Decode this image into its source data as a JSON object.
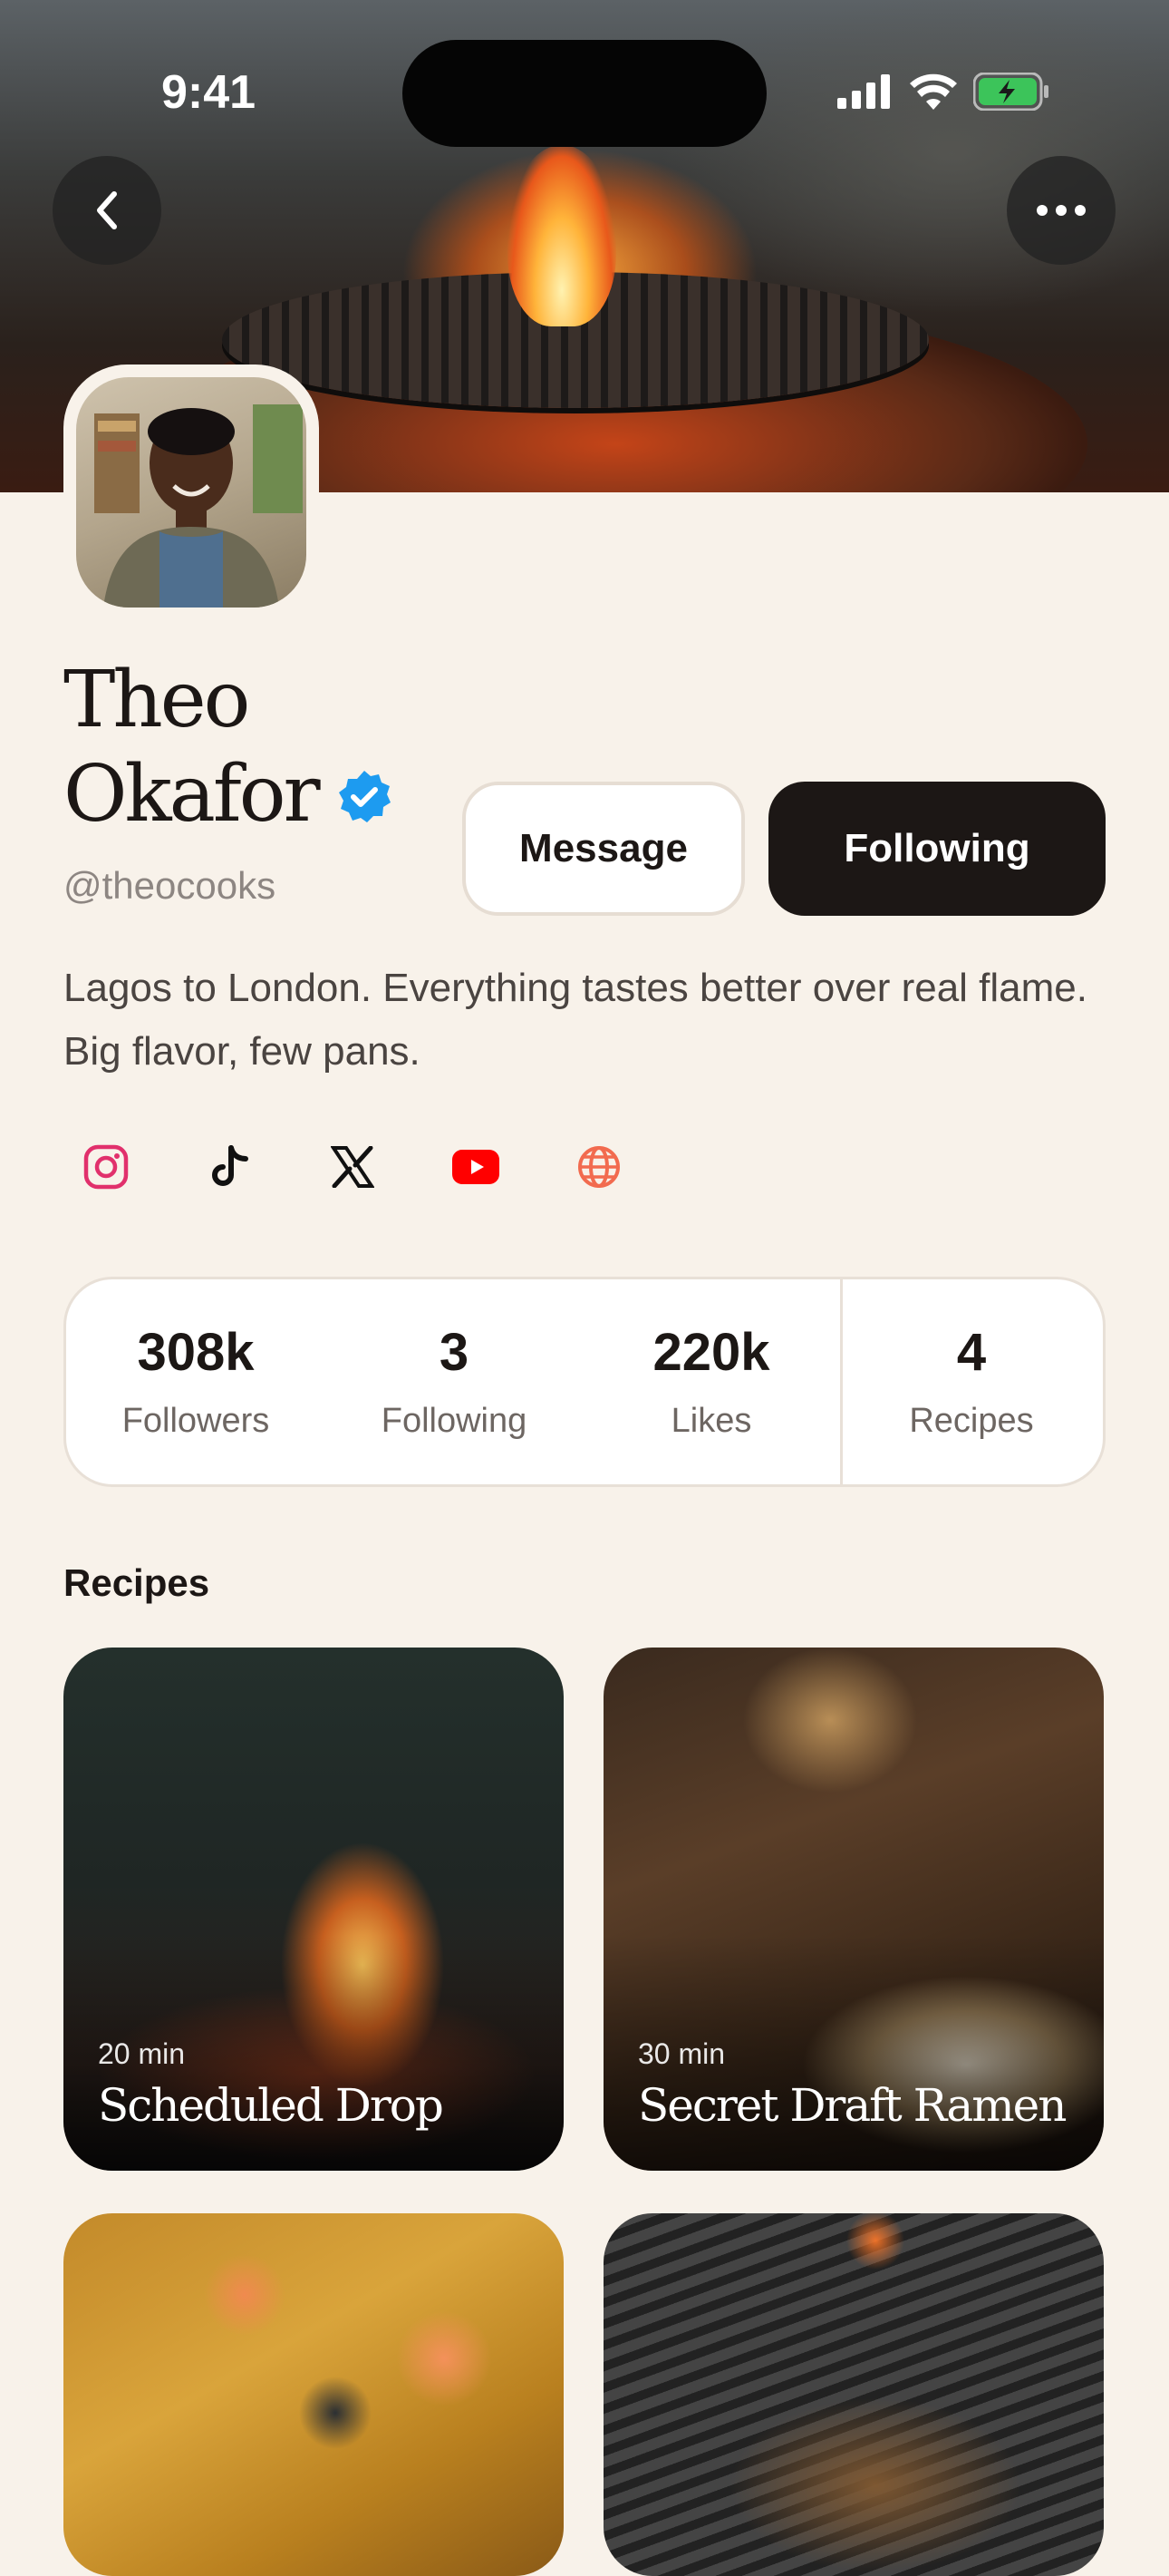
{
  "status_bar": {
    "time": "9:41"
  },
  "header": {
    "back_icon": "chevron-left-icon",
    "more_icon": "more-horizontal-icon"
  },
  "profile": {
    "first_name": "Theo",
    "last_name": "Okafor",
    "verified": true,
    "handle": "@theocooks",
    "bio": "Lagos to London. Everything tastes better over real flame. Big flavor, few pans.",
    "accent_color": "#1d9bf0"
  },
  "actions": {
    "message_label": "Message",
    "following_label": "Following"
  },
  "socials": [
    {
      "name": "instagram-icon",
      "color": "#e1306c"
    },
    {
      "name": "tiktok-icon",
      "color": "#111111"
    },
    {
      "name": "x-icon",
      "color": "#111111"
    },
    {
      "name": "youtube-icon",
      "color": "#ff0000"
    },
    {
      "name": "globe-icon",
      "color": "#f26b4f"
    }
  ],
  "stats": {
    "followers": {
      "value": "308k",
      "label": "Followers"
    },
    "following": {
      "value": "3",
      "label": "Following"
    },
    "likes": {
      "value": "220k",
      "label": "Likes"
    },
    "recipes": {
      "value": "4",
      "label": "Recipes"
    }
  },
  "recipes_section": {
    "title": "Recipes",
    "cards": [
      {
        "time": "20 min",
        "title": "Scheduled Drop"
      },
      {
        "time": "30 min",
        "title": "Secret Draft Ramen"
      },
      {
        "time": "",
        "title": ""
      },
      {
        "time": "",
        "title": ""
      }
    ]
  }
}
